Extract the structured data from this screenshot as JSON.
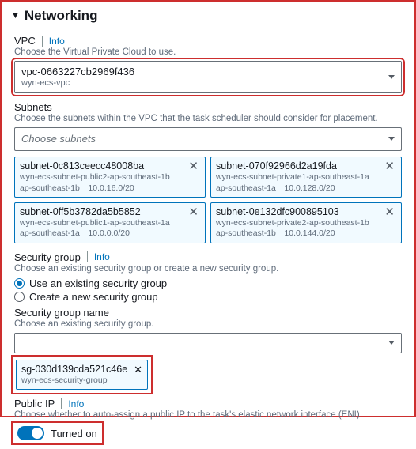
{
  "section": {
    "title": "Networking"
  },
  "vpc": {
    "label": "VPC",
    "info": "Info",
    "hint": "Choose the Virtual Private Cloud to use.",
    "value": "vpc-0663227cb2969f436",
    "sub": "wyn-ecs-vpc"
  },
  "subnets": {
    "label": "Subnets",
    "hint": "Choose the subnets within the VPC that the task scheduler should consider for placement.",
    "placeholder": "Choose subnets",
    "items": [
      {
        "id": "subnet-0c813ceecc48008ba",
        "desc": "wyn-ecs-subnet-public2-ap-southeast-1b",
        "az": "ap-southeast-1b",
        "cidr": "10.0.16.0/20"
      },
      {
        "id": "subnet-070f92966d2a19fda",
        "desc": "wyn-ecs-subnet-private1-ap-southeast-1a",
        "az": "ap-southeast-1a",
        "cidr": "10.0.128.0/20"
      },
      {
        "id": "subnet-0ff5b3782da5b5852",
        "desc": "wyn-ecs-subnet-public1-ap-southeast-1a",
        "az": "ap-southeast-1a",
        "cidr": "10.0.0.0/20"
      },
      {
        "id": "subnet-0e132dfc900895103",
        "desc": "wyn-ecs-subnet-private2-ap-southeast-1b",
        "az": "ap-southeast-1b",
        "cidr": "10.0.144.0/20"
      }
    ]
  },
  "securityGroup": {
    "label": "Security group",
    "info": "Info",
    "hint": "Choose an existing security group or create a new security group.",
    "radio_existing": "Use an existing security group",
    "radio_new": "Create a new security group",
    "name_label": "Security group name",
    "name_hint": "Choose an existing security group.",
    "chip_id": "sg-030d139cda521c46e",
    "chip_desc": "wyn-ecs-security-group"
  },
  "publicIp": {
    "label": "Public IP",
    "info": "Info",
    "hint": "Choose whether to auto-assign a public IP to the task's elastic network interface (ENI).",
    "state": "Turned on"
  }
}
